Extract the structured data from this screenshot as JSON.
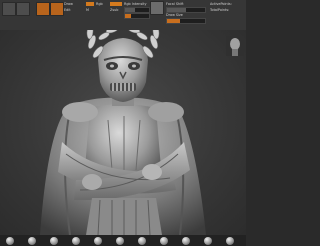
{
  "app": {
    "name": "ZBrush"
  },
  "toolbar": {
    "draw_mode": "Draw",
    "edit": "Edit",
    "move": "Move",
    "scale": "Scale",
    "rotate": "Rotate",
    "mrgb": "Mrgb",
    "rgb": "Rgb",
    "m": "M",
    "zadd": "Zadd",
    "zsub": "Zsub",
    "rgb_intensity_label": "Rgb Intensity",
    "z_intensity_label": "Z Intensity",
    "focal_shift_label": "Focal Shift",
    "draw_size_label": "Draw Size",
    "dynamic_label": "Dynamic",
    "zadd_value": 25,
    "z_intensity_value": 25,
    "focal_shift_value": 0,
    "draw_size_value": 64
  },
  "panels": {
    "active_points_label": "ActivePoints:",
    "total_points_label": "TotalPoints:"
  },
  "viewport": {
    "subject": "laurel-crowned zombie bust with crossed arms and cape"
  },
  "bottom_shelf": {
    "brush_count": 11
  },
  "colors": {
    "accent_orange": "#d47a1e",
    "ui_panel": "#363636",
    "viewport_bg": "#3a3a3a"
  }
}
